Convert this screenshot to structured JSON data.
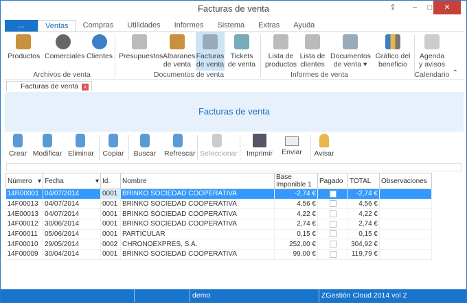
{
  "window": {
    "title": "Facturas de venta"
  },
  "tabs": [
    {
      "label": "..."
    },
    {
      "label": "Ventas"
    },
    {
      "label": "Compras"
    },
    {
      "label": "Utilidades"
    },
    {
      "label": "Informes"
    },
    {
      "label": "Sistema"
    },
    {
      "label": "Extras"
    },
    {
      "label": "Ayuda"
    }
  ],
  "ribbon": {
    "buttons": [
      {
        "label": "Productos"
      },
      {
        "label": "Comerciales"
      },
      {
        "label": "Clientes"
      },
      {
        "label": "Presupuestos"
      },
      {
        "label": "Albaranes de venta"
      },
      {
        "label": "Facturas de venta"
      },
      {
        "label": "Tickets de venta"
      },
      {
        "label": "Lista de productos"
      },
      {
        "label": "Lista de clientes"
      },
      {
        "label": "Documentos de venta ▾"
      },
      {
        "label": "Gráfico del beneficio"
      },
      {
        "label": "Agenda y avisos"
      }
    ],
    "groups": [
      {
        "label": "Archivos de venta"
      },
      {
        "label": "Documentos de venta"
      },
      {
        "label": "Informes de venta"
      },
      {
        "label": "Calendario"
      }
    ]
  },
  "doc_tab": {
    "label": "Facturas de venta",
    "close": "x"
  },
  "band": {
    "title": "Facturas de venta"
  },
  "toolbar": [
    {
      "label": "Crear"
    },
    {
      "label": "Modificar"
    },
    {
      "label": "Eliminar"
    },
    {
      "label": "Copiar"
    },
    {
      "label": "Buscar"
    },
    {
      "label": "Refrescar"
    },
    {
      "label": "Seleccionar"
    },
    {
      "label": "Imprimir"
    },
    {
      "label": "Enviar"
    },
    {
      "label": "Avisar"
    }
  ],
  "grid": {
    "columns": [
      "Número",
      "Fecha",
      "Id.",
      "Nombre",
      "Base Imponible 1",
      "Pagado",
      "TOTAL",
      "Observaciones"
    ],
    "rows": [
      {
        "numero": "14R00001",
        "fecha": "04/07/2014",
        "id": "0001",
        "nombre": "BRINKO SOCIEDAD COOPERATIVA",
        "base": "-2,74 €",
        "pagado": false,
        "total": "-2,74 €",
        "obs": ""
      },
      {
        "numero": "14F00013",
        "fecha": "04/07/2014",
        "id": "0001",
        "nombre": "BRINKO SOCIEDAD COOPERATIVA",
        "base": "4,56 €",
        "pagado": false,
        "total": "4,56 €",
        "obs": ""
      },
      {
        "numero": "14E00013",
        "fecha": "04/07/2014",
        "id": "0001",
        "nombre": "BRINKO SOCIEDAD COOPERATIVA",
        "base": "4,22 €",
        "pagado": false,
        "total": "4,22 €",
        "obs": ""
      },
      {
        "numero": "14F00012",
        "fecha": "30/06/2014",
        "id": "0001",
        "nombre": "BRINKO SOCIEDAD COOPERATIVA",
        "base": "2,74 €",
        "pagado": false,
        "total": "2,74 €",
        "obs": ""
      },
      {
        "numero": "14F00011",
        "fecha": "05/06/2014",
        "id": "0001",
        "nombre": "PARTICULAR",
        "base": "0,15 €",
        "pagado": false,
        "total": "0,15 €",
        "obs": ""
      },
      {
        "numero": "14F00010",
        "fecha": "29/05/2014",
        "id": "0002",
        "nombre": "CHRONOEXPRES, S.A.",
        "base": "252,00 €",
        "pagado": false,
        "total": "304,92 €",
        "obs": ""
      },
      {
        "numero": "14F00009",
        "fecha": "30/04/2014",
        "id": "0001",
        "nombre": "BRINKO SOCIEDAD COOPERATIVA",
        "base": "99,00 €",
        "pagado": false,
        "total": "119,79 €",
        "obs": ""
      }
    ]
  },
  "status": {
    "user": "demo",
    "product": "ZGestión Cloud 2014 vol 2"
  }
}
